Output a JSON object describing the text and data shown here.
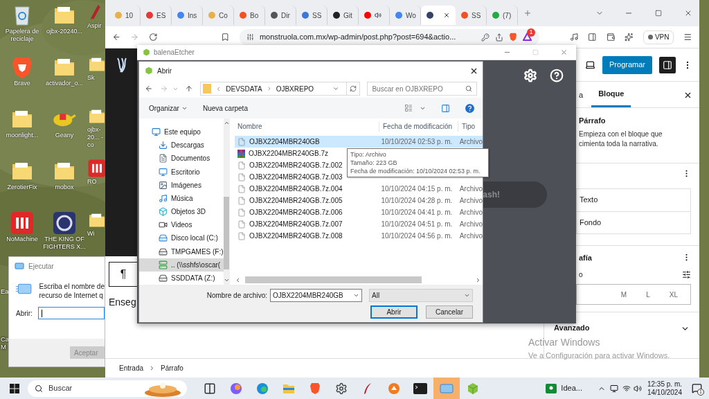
{
  "desktop_icons": [
    {
      "label": "Papelera de reciclaje",
      "kind": "recycle"
    },
    {
      "label": "ojbx-20240...",
      "kind": "folder"
    },
    {
      "label": "Aspir",
      "kind": "app"
    },
    {
      "label": "Brave",
      "kind": "brave"
    },
    {
      "label": "activador_o...",
      "kind": "folder"
    },
    {
      "label": "Sk",
      "kind": "folder"
    },
    {
      "label": "moonlight...",
      "kind": "folder"
    },
    {
      "label": "Geany",
      "kind": "geany"
    },
    {
      "label": "ojbx-20... - co",
      "kind": "folder"
    },
    {
      "label": "ZerotierFix",
      "kind": "folder"
    },
    {
      "label": "mobox",
      "kind": "folder"
    },
    {
      "label": "RO",
      "kind": "nomachine"
    },
    {
      "label": "NoMachine",
      "kind": "nomachine"
    },
    {
      "label": "THE KING OF FIGHTERS X...",
      "kind": "game"
    },
    {
      "label": "Wi",
      "kind": "folder"
    }
  ],
  "desktop_partial_labels": [
    "Ea",
    "Ca",
    "M"
  ],
  "run_dialog": {
    "title": "Ejecutar",
    "message_lines": [
      "Escriba el nombre de",
      "recurso de Internet q"
    ],
    "open_label": "Abrir:",
    "ok_button": "Aceptar"
  },
  "browser": {
    "tabs": [
      {
        "label": "10",
        "color": "#e8b04a",
        "selected": false
      },
      {
        "label": "ES",
        "color": "#e53935",
        "selected": false
      },
      {
        "label": "Ins",
        "color": "#4285f4",
        "selected": false
      },
      {
        "label": "Co",
        "color": "#e8b04a",
        "selected": false
      },
      {
        "label": "Bo",
        "color": "#f4511e",
        "selected": false
      },
      {
        "label": "Dir",
        "color": "#555555",
        "selected": false
      },
      {
        "label": "SS",
        "color": "#3c78d8",
        "selected": false
      },
      {
        "label": "Git",
        "color": "#222222",
        "selected": false
      },
      {
        "color": "#ff0000",
        "audio": true,
        "selected": false
      },
      {
        "label": "Wo",
        "color": "#4285f4",
        "selected": false
      },
      {
        "color": "#334466",
        "selected": true
      },
      {
        "label": "SS",
        "color": "#f25022",
        "selected": false
      },
      {
        "label": "(7)",
        "color": "#22aa44",
        "selected": false
      }
    ],
    "address": "monstruola.com.mx/wp-admin/post.php?post=694&actio...",
    "rewards_badge": "1",
    "vpn": "VPN"
  },
  "editor": {
    "publish_button": "Programar",
    "paragraph_mark": "¶",
    "heading": "Enseg",
    "breadcrumb": [
      "Entrada",
      "Párrafo"
    ],
    "sidebar": {
      "tabs": [
        {
          "label": "a",
          "selected": false
        },
        {
          "label": "Bloque",
          "selected": true
        }
      ],
      "block_title": "Párrafo",
      "block_description": "Empieza con el bloque que cimienta toda la narrativa.",
      "colors": [
        "Texto",
        "Fondo"
      ],
      "typography_title": "afía",
      "size_label": "o",
      "sizes": [
        "M",
        "L",
        "XL"
      ],
      "advanced": "Avanzado"
    }
  },
  "etcher": {
    "title": "balenaEtcher",
    "flash_button": "ash!"
  },
  "open_dialog": {
    "title": "Abrir",
    "path": [
      "DEVSDATA",
      "OJBXREPO"
    ],
    "search_placeholder": "Buscar en OJBXREPO",
    "organize": "Organizar",
    "new_folder": "Nueva carpeta",
    "nav": [
      {
        "label": "Este equipo",
        "kind": "pc",
        "selected": false
      },
      {
        "label": "Descargas",
        "kind": "download",
        "selected": false
      },
      {
        "label": "Documentos",
        "kind": "docs",
        "selected": false
      },
      {
        "label": "Escritorio",
        "kind": "desktop",
        "selected": false
      },
      {
        "label": "Imágenes",
        "kind": "images",
        "selected": false
      },
      {
        "label": "Música",
        "kind": "music",
        "selected": false
      },
      {
        "label": "Objetos 3D",
        "kind": "objects",
        "selected": false
      },
      {
        "label": "Videos",
        "kind": "video",
        "selected": false
      },
      {
        "label": "Disco local (C:)",
        "kind": "system_disk",
        "selected": false
      },
      {
        "label": "TMPGAMES (F:)",
        "kind": "drive",
        "selected": false
      },
      {
        "label": ".. (\\\\sshfs\\oscar(",
        "kind": "network",
        "selected": true
      },
      {
        "label": "SSDDATA (Z:)",
        "kind": "drive",
        "selected": false
      }
    ],
    "columns": [
      "Nombre",
      "Fecha de modificación",
      "Tipo"
    ],
    "files": [
      {
        "name": "OJBX2204MBR240GB",
        "kind": "file",
        "date": "10/10/2024 02:53 p. m.",
        "type": "Archivo",
        "selected": true
      },
      {
        "name": "OJBX2204MBR240GB.7z",
        "kind": "archive",
        "selected": false
      },
      {
        "name": "OJBX2204MBR240GB.7z.002",
        "kind": "file",
        "selected": false
      },
      {
        "name": "OJBX2204MBR240GB.7z.003",
        "kind": "file",
        "selected": false
      },
      {
        "name": "OJBX2204MBR240GB.7z.004",
        "kind": "file",
        "date": "10/10/2024 04:15 p. m.",
        "type": "Archivo",
        "selected": false
      },
      {
        "name": "OJBX2204MBR240GB.7z.005",
        "kind": "file",
        "date": "10/10/2024 04:28 p. m.",
        "type": "Archivo",
        "selected": false
      },
      {
        "name": "OJBX2204MBR240GB.7z.006",
        "kind": "file",
        "date": "10/10/2024 04:41 p. m.",
        "type": "Archivo",
        "selected": false
      },
      {
        "name": "OJBX2204MBR240GB.7z.007",
        "kind": "file",
        "date": "10/10/2024 04:51 p. m.",
        "type": "Archivo",
        "selected": false
      },
      {
        "name": "OJBX2204MBR240GB.7z.008",
        "kind": "file",
        "date": "10/10/2024 04:56 p. m.",
        "type": "Archivo",
        "selected": false
      }
    ],
    "tooltip": [
      "Tipo: Archivo",
      "Tamaño: 223 GB",
      "Fecha de modificación: 10/10/2024 02:53 p. m."
    ],
    "filename_label": "Nombre de archivo:",
    "filename": "OJBX2204MBR240GB",
    "filter": "All",
    "open_button": "Abrir",
    "cancel_button": "Cancelar"
  },
  "activation_notice": {
    "title": "Activar Windows",
    "message": "Ve a Configuración para activar Windows."
  },
  "taskbar": {
    "search_placeholder": "Buscar",
    "apps": [
      {
        "kind": "taskview",
        "active": false
      },
      {
        "kind": "copilot",
        "active": false
      },
      {
        "kind": "edge",
        "active": false
      },
      {
        "kind": "explorer",
        "active": false
      },
      {
        "kind": "brave",
        "active": false
      },
      {
        "kind": "settings",
        "active": false
      },
      {
        "kind": "feather",
        "active": false
      },
      {
        "kind": "orange",
        "active": false
      },
      {
        "kind": "terminal",
        "active": false
      },
      {
        "kind": "run",
        "active": true
      },
      {
        "kind": "etcher",
        "active": false
      }
    ],
    "widget": "Idea...",
    "time": "12:35 p. m.",
    "date": "14/10/2024",
    "notifications": "1"
  }
}
